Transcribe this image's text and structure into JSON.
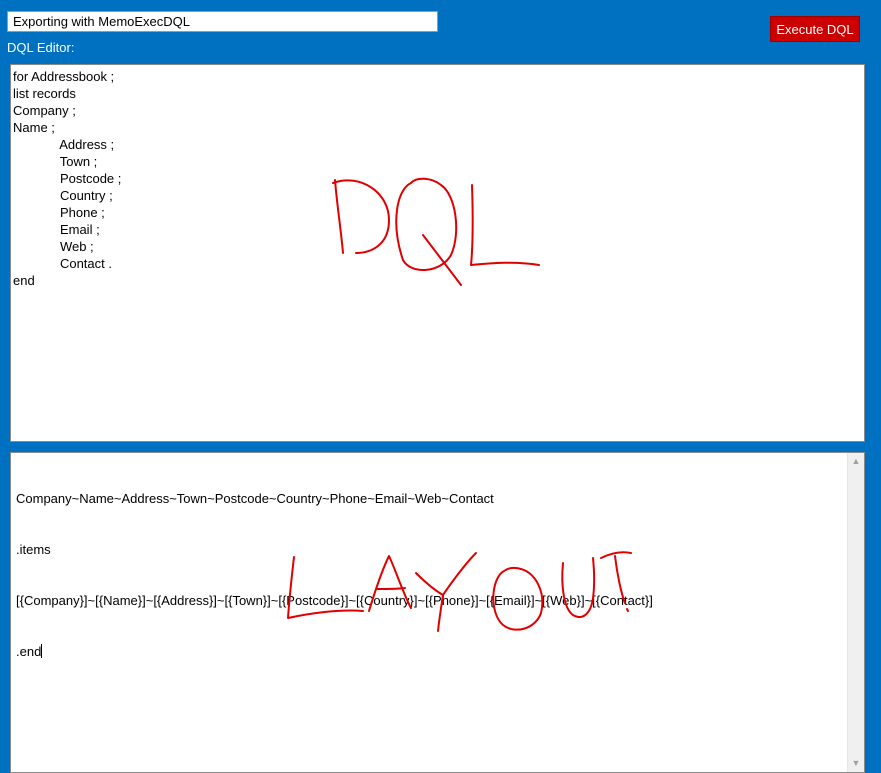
{
  "header": {
    "title_value": "Exporting with MemoExecDQL",
    "execute_label": "Execute DQL",
    "dql_editor_label": "DQL Editor:"
  },
  "dql_editor": {
    "content": "for Addressbook ;\nlist records\nCompany ;\nName ;\n             Address ;\n             Town ;\n             Postcode ;\n             Country ;\n             Phone ;\n             Email ;\n             Web ;\n             Contact .\nend",
    "handwritten_annotation": "DQL"
  },
  "layout_editor": {
    "lines": [
      "Company~Name~Address~Town~Postcode~Country~Phone~Email~Web~Contact",
      ".items",
      "[{Company}]~[{Name}]~[{Address}]~[{Town}]~[{Postcode}]~[{Country}]~[{Phone}]~[{Email}]~[{Web}]~[{Contact}]"
    ],
    "last_line": ".end",
    "handwritten_annotation": "LAYOUT"
  },
  "colors": {
    "background": "#0070C0",
    "execute_button": "#CC0000",
    "annotation_ink": "#E00000"
  },
  "icons": {
    "scroll_up": "chevron-up-icon",
    "scroll_down": "chevron-down-icon"
  }
}
